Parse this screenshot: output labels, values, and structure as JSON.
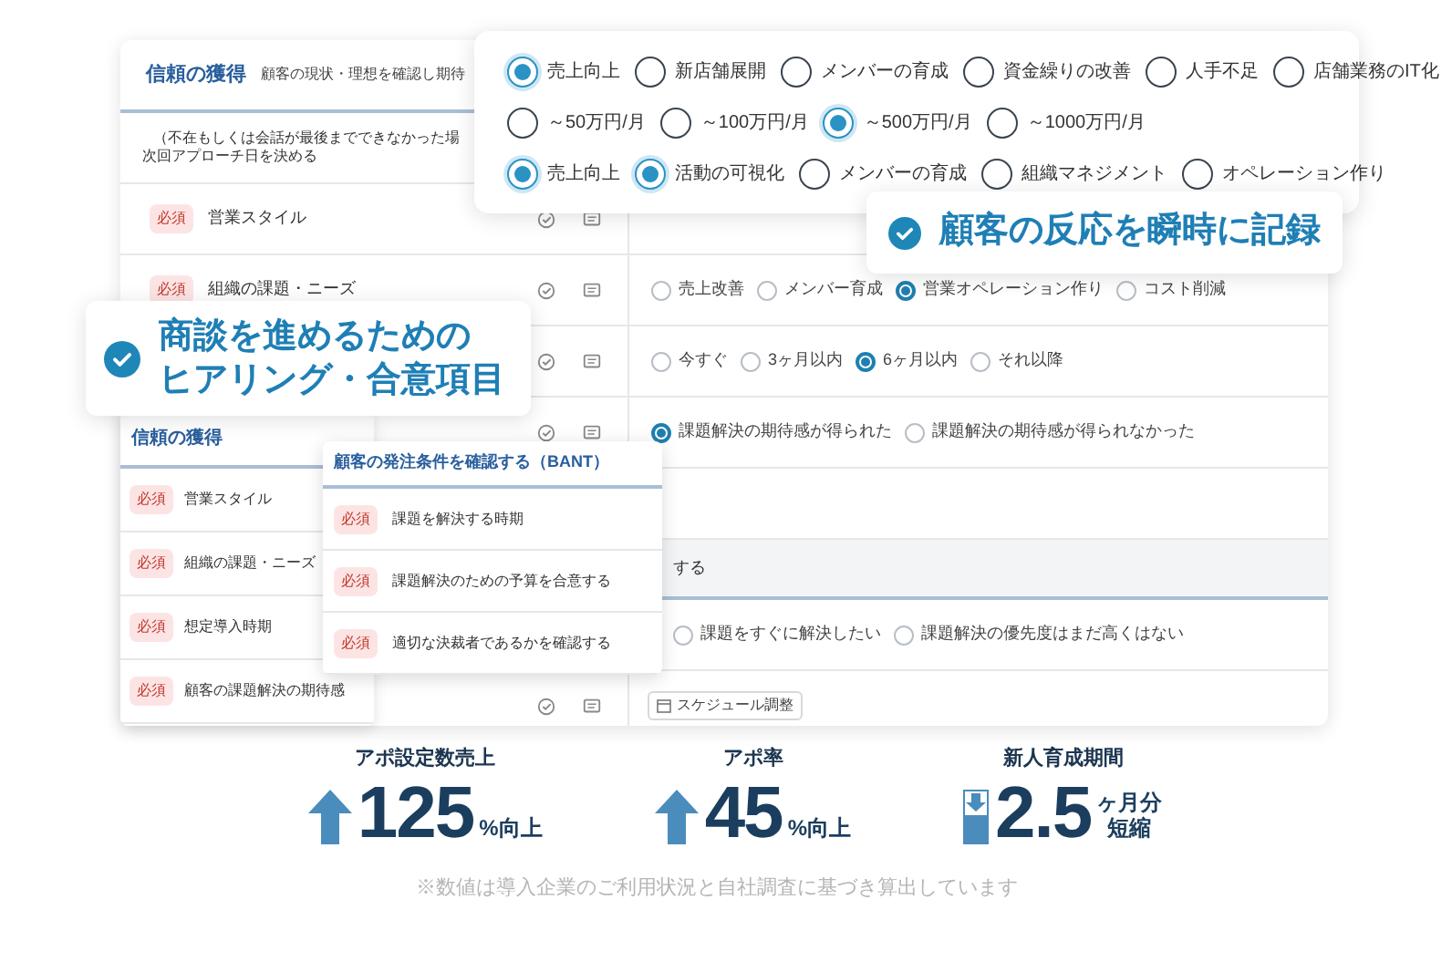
{
  "back_card": {
    "title": "信頼の獲得",
    "subtitle": "顧客の現状・理想を確認し期待",
    "rows": [
      {
        "kind": "note",
        "lines": [
          "（不在もしくは会話が最後までできなかった場",
          "次回アプローチ日を決める"
        ]
      },
      {
        "kind": "item",
        "badge": "必須",
        "label": "営業スタイル"
      },
      {
        "kind": "item",
        "badge": "必須",
        "label": "組織の課題・ニーズ",
        "options": [
          {
            "label": "売上改善",
            "selected": false
          },
          {
            "label": "メンバー育成",
            "selected": false
          },
          {
            "label": "営業オペレーション作り",
            "selected": true
          },
          {
            "label": "コスト削減",
            "selected": false
          }
        ]
      },
      {
        "kind": "item",
        "options": [
          {
            "label": "今すぐ",
            "selected": false
          },
          {
            "label": "3ヶ月以内",
            "selected": false
          },
          {
            "label": "6ヶ月以内",
            "selected": true
          },
          {
            "label": "それ以降",
            "selected": false
          }
        ]
      },
      {
        "kind": "item",
        "options": [
          {
            "label": "課題解決の期待感が得られた",
            "selected": true
          },
          {
            "label": "課題解決の期待感が得られなかった",
            "selected": false
          }
        ]
      },
      {
        "kind": "blank"
      },
      {
        "kind": "section",
        "label": "する"
      },
      {
        "kind": "options",
        "options": [
          {
            "label": "課題をすぐに解決したい",
            "selected": false
          },
          {
            "label": "課題解決の優先度はまだ高くはない",
            "selected": false
          }
        ]
      },
      {
        "kind": "button",
        "label": "スケジュール調整",
        "actions": true
      }
    ]
  },
  "front_card": {
    "title": "信頼の獲得",
    "rows": [
      {
        "badge": "必須",
        "label": "営業スタイル"
      },
      {
        "badge": "必須",
        "label": "組織の課題・ニーズ"
      },
      {
        "badge": "必須",
        "label": "想定導入時期"
      },
      {
        "badge": "必須",
        "label": "顧客の課題解決の期待感"
      }
    ]
  },
  "bant_card": {
    "title": "顧客の発注条件を確認する（BANT）",
    "rows": [
      {
        "badge": "必須",
        "label": "課題を解決する時期"
      },
      {
        "badge": "必須",
        "label": "課題解決のための予算を合意する"
      },
      {
        "badge": "必須",
        "label": "適切な決裁者であるかを確認する"
      }
    ]
  },
  "options_card": {
    "groups": [
      [
        {
          "label": "売上向上",
          "selected": true
        },
        {
          "label": "新店舗展開",
          "selected": false
        },
        {
          "label": "メンバーの育成",
          "selected": false
        },
        {
          "label": "資金繰りの改善",
          "selected": false
        },
        {
          "label": "人手不足",
          "selected": false
        },
        {
          "label": "店舗業務のIT化",
          "selected": false
        }
      ],
      [
        {
          "label": "～50万円/月",
          "selected": false
        },
        {
          "label": "～100万円/月",
          "selected": false
        },
        {
          "label": "～500万円/月",
          "selected": true
        },
        {
          "label": "～1000万円/月",
          "selected": false
        }
      ],
      [
        {
          "label": "売上向上",
          "selected": true
        },
        {
          "label": "活動の可視化",
          "selected": true
        },
        {
          "label": "メンバーの育成",
          "selected": false
        },
        {
          "label": "組織マネジメント",
          "selected": false
        },
        {
          "label": "オペレーション作り",
          "selected": false
        }
      ]
    ]
  },
  "callouts": [
    {
      "lines": [
        "顧客の反応を瞬時に記録"
      ]
    },
    {
      "lines": [
        "商談を進めるための",
        "ヒアリング・合意項目"
      ]
    }
  ],
  "stats": [
    {
      "label": "アポ設定数売上",
      "kind": "up",
      "value": "125",
      "unit_lines": [
        "%向上"
      ]
    },
    {
      "label": "アポ率",
      "kind": "up",
      "value": "45",
      "unit_lines": [
        "%向上"
      ]
    },
    {
      "label": "新人育成期間",
      "kind": "down",
      "value": "2.5",
      "unit_lines": [
        "ヶ月分",
        "短縮"
      ]
    }
  ],
  "footnote": "※数値は導入企業のご利用状況と自社調査に基づき算出しています"
}
